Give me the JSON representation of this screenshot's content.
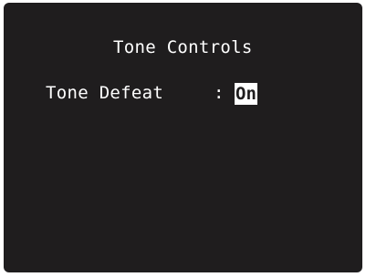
{
  "menu": {
    "title": "Tone Controls",
    "items": [
      {
        "label": "Tone Defeat",
        "separator": ":",
        "value": "On",
        "selected": true
      }
    ]
  },
  "colors": {
    "screen_background": "#1f1d1e",
    "text": "#ffffff",
    "highlight_background": "#ffffff",
    "highlight_text": "#1f1d1e"
  }
}
